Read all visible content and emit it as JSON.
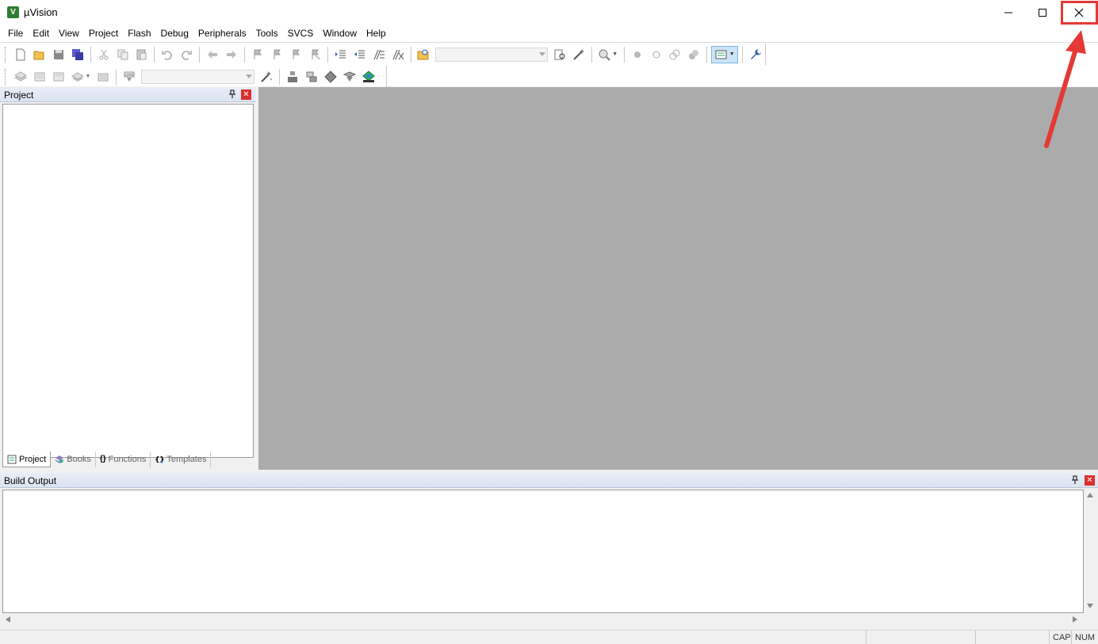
{
  "window": {
    "title": "µVision",
    "icon_label": "V"
  },
  "menu": [
    "File",
    "Edit",
    "View",
    "Project",
    "Flash",
    "Debug",
    "Peripherals",
    "Tools",
    "SVCS",
    "Window",
    "Help"
  ],
  "toolbar1_icons": [
    "new-file-icon",
    "open-file-icon",
    "save-icon",
    "save-all-icon",
    "cut-icon",
    "copy-icon",
    "paste-icon",
    "undo-icon",
    "redo-icon",
    "navigate-back-icon",
    "navigate-forward-icon",
    "bookmark-icon",
    "prev-bookmark-icon",
    "next-bookmark-icon",
    "clear-bookmarks-icon",
    "indent-icon",
    "unindent-icon",
    "comment-icon",
    "uncomment-icon",
    "find-in-files-icon"
  ],
  "toolbar2_icons": [
    "translate-icon",
    "build-icon",
    "rebuild-icon",
    "batch-build-icon",
    "stop-build-icon",
    "download-icon",
    "target-options-icon",
    "manage-components-icon",
    "select-packs-icon",
    "pack-installer-icon",
    "run-environment-icon"
  ],
  "project_panel": {
    "title": "Project",
    "tabs": [
      {
        "label": "Project",
        "icon": "project-icon",
        "active": true
      },
      {
        "label": "Books",
        "icon": "books-icon",
        "active": false
      },
      {
        "label": "Functions",
        "icon": "functions-icon",
        "active": false
      },
      {
        "label": "Templates",
        "icon": "templates-icon",
        "active": false
      }
    ]
  },
  "functions_glyph": "{}",
  "build_output": {
    "title": "Build Output"
  },
  "statusbar": {
    "cap": "CAP",
    "num": "NUM"
  },
  "colors": {
    "editor_bg": "#ababab",
    "highlight": "#e53935"
  }
}
